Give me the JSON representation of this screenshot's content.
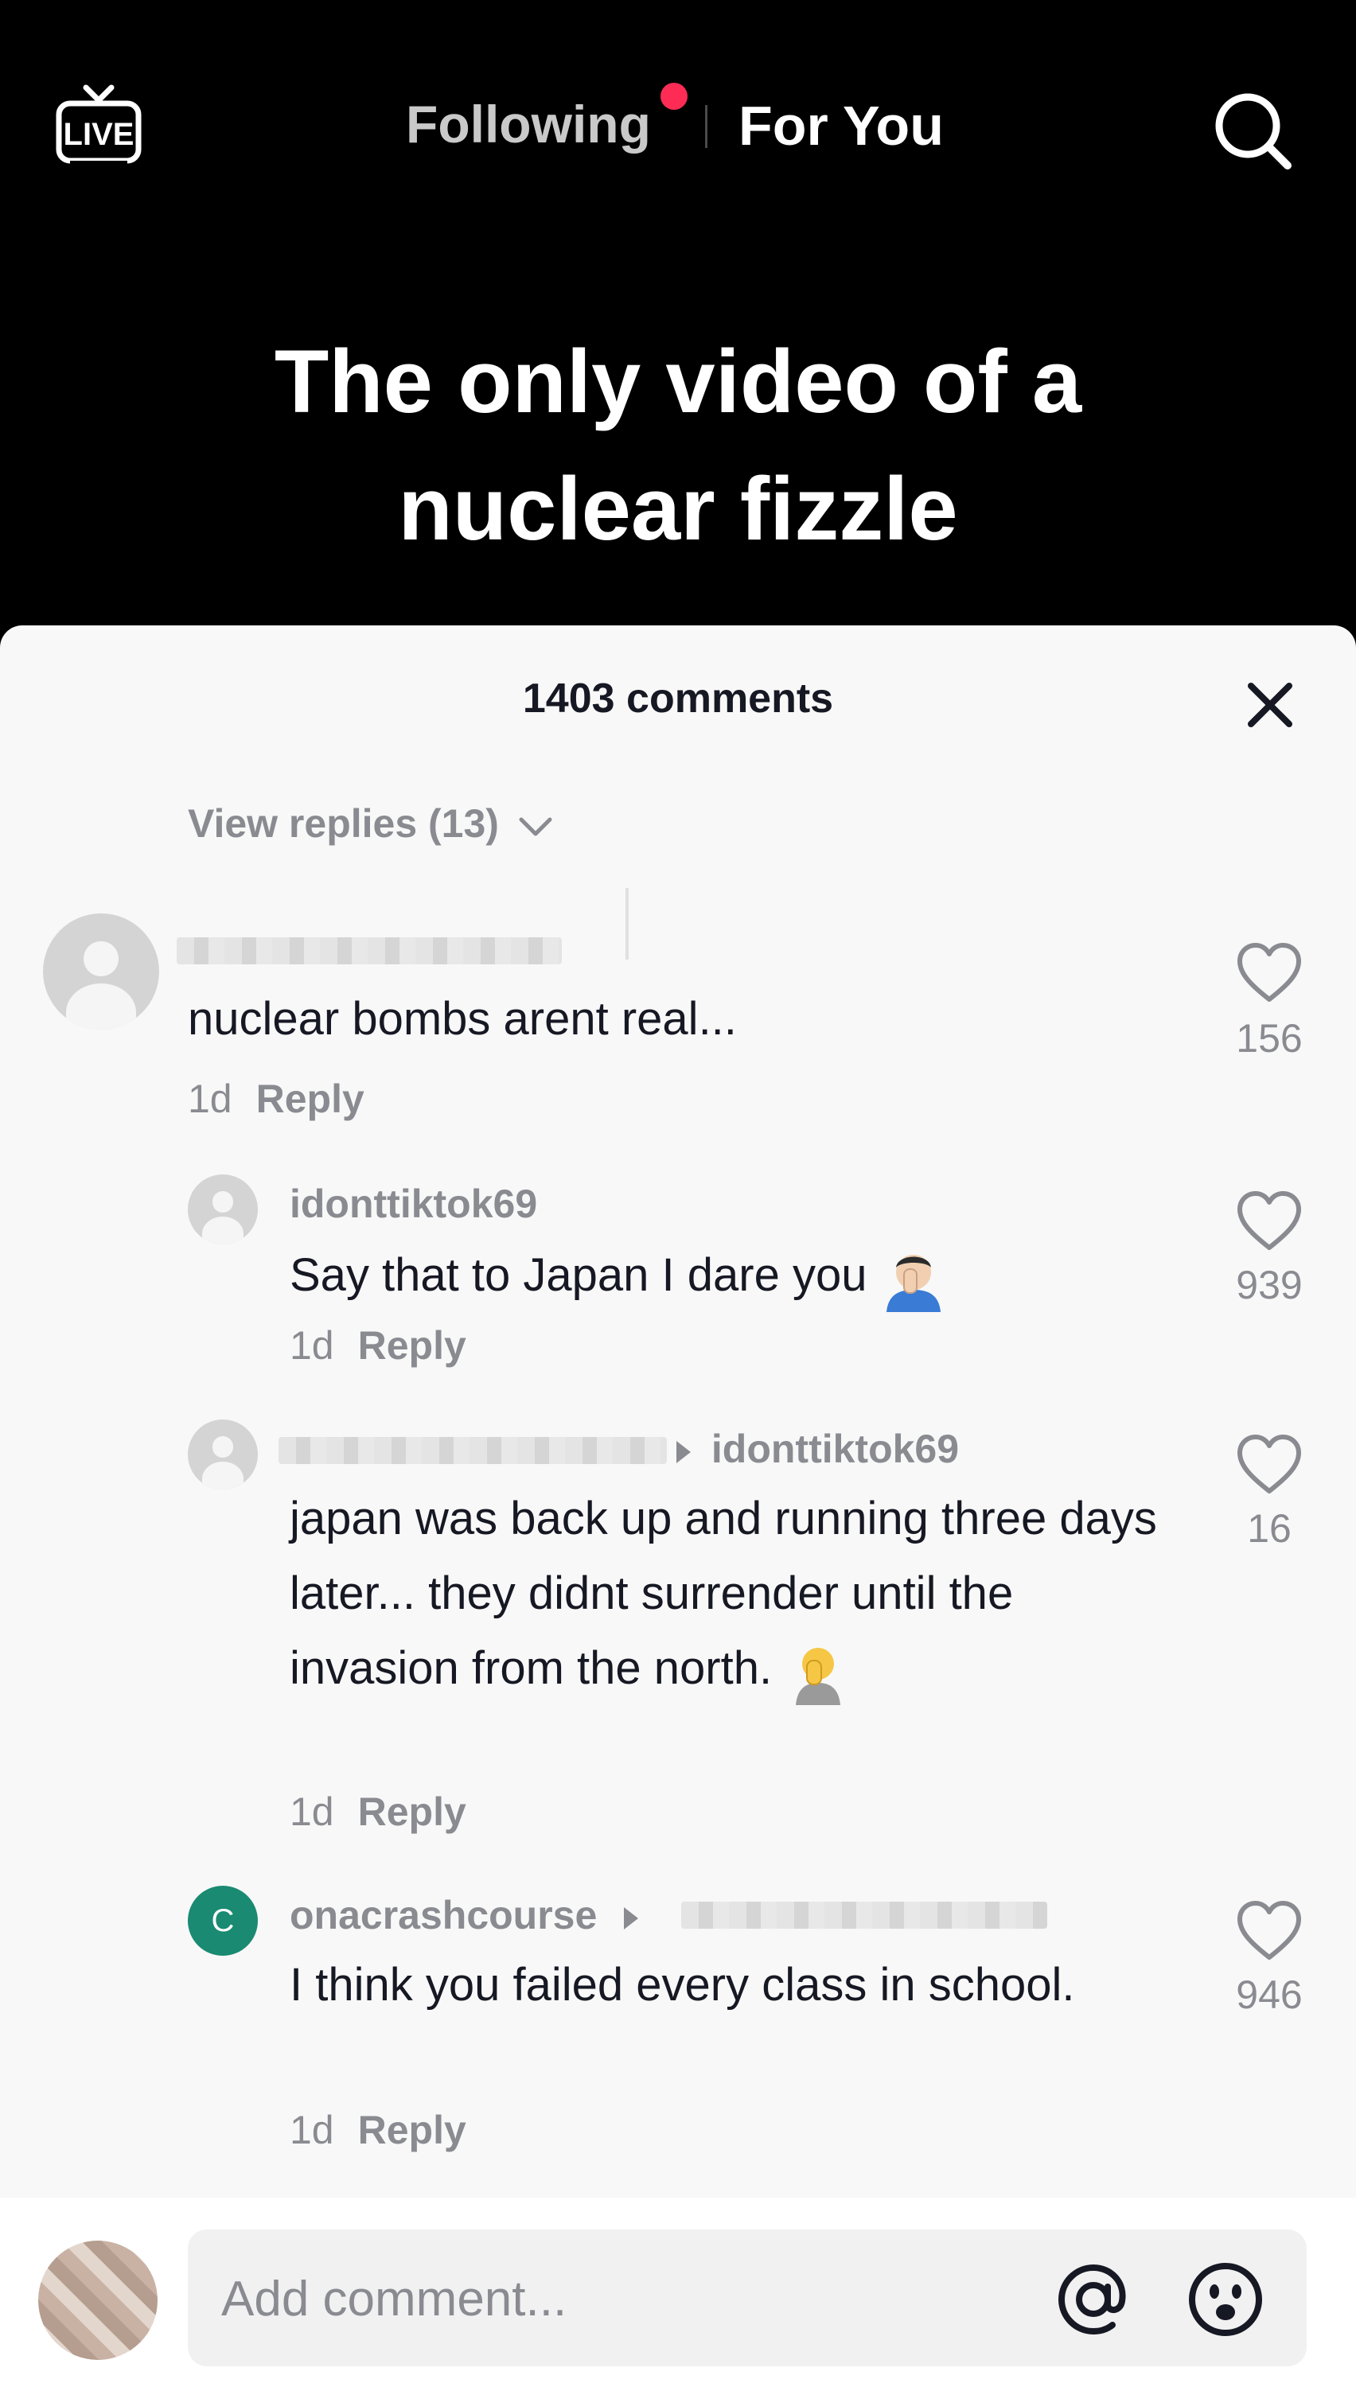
{
  "top_nav": {
    "live_label": "LIVE",
    "following_label": "Following",
    "for_you_label": "For You"
  },
  "video": {
    "caption_line1": "The only video of a",
    "caption_line2": "nuclear fizzle"
  },
  "comments_sheet": {
    "title": "1403 comments",
    "view_replies": "View replies (13)",
    "comments": [
      {
        "username": "",
        "text": "nuclear bombs arent real...",
        "time": "1d",
        "reply_label": "Reply",
        "likes": "156"
      },
      {
        "username": "idonttiktok69",
        "text": "Say that to Japan I dare you",
        "emoji": "facepalm-emoji",
        "time": "1d",
        "reply_label": "Reply",
        "likes": "939"
      },
      {
        "username": "",
        "reply_to": "idonttiktok69",
        "text": "japan was back up and running three days later... they didnt surrender until the invasion from the north.",
        "emoji": "facepalm-emoji",
        "time": "1d",
        "reply_label": "Reply",
        "likes": "16"
      },
      {
        "avatar_letter": "C",
        "username": "onacrashcourse",
        "reply_to": "",
        "text": "I think you failed every class in school.",
        "time": "1d",
        "reply_label": "Reply",
        "likes": "946"
      }
    ]
  },
  "input_bar": {
    "placeholder": "Add comment..."
  },
  "colors": {
    "accent_red": "#fe2c55",
    "sheet_bg": "#f8f8f8",
    "muted_text": "#8a8b91",
    "primary_text": "#161823",
    "avatar_c_bg": "#1a8a72"
  }
}
